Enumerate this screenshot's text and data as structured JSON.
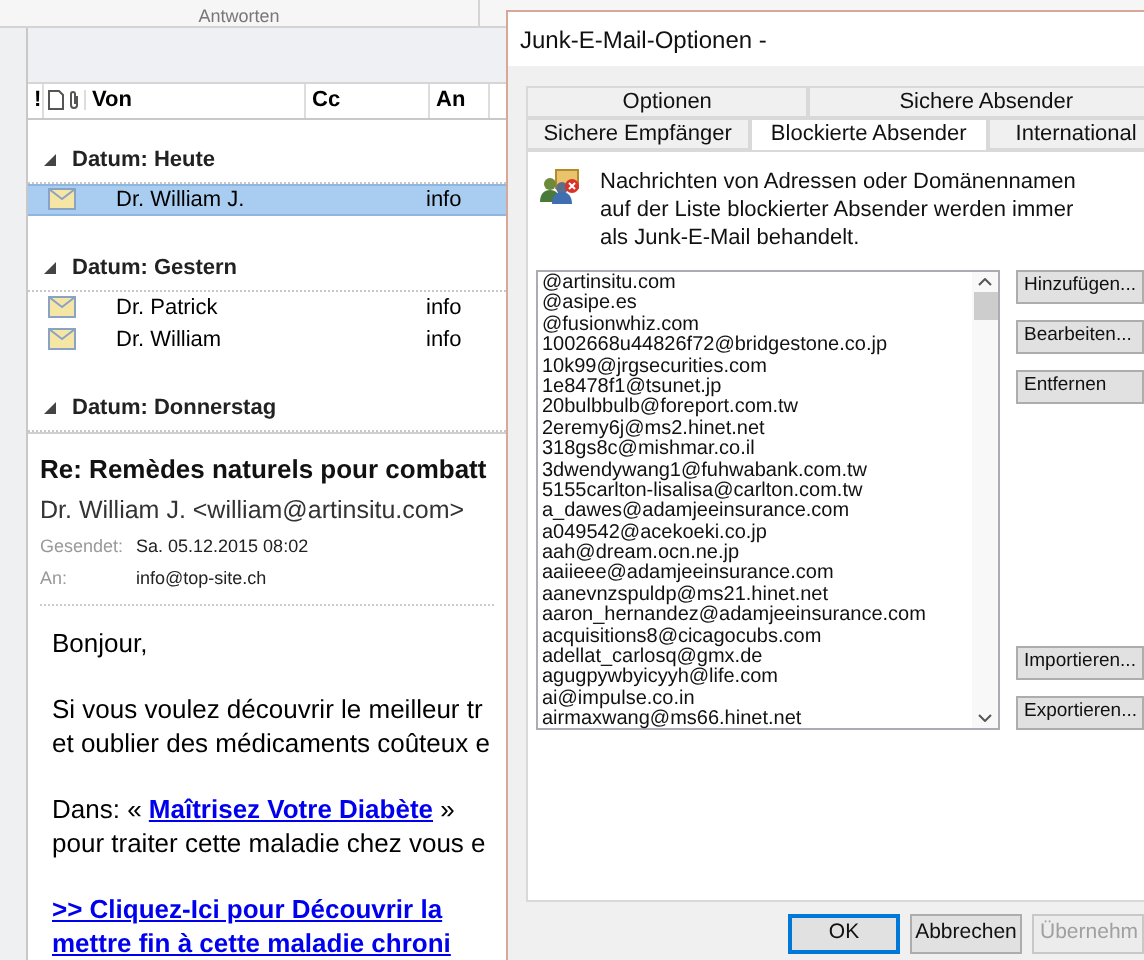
{
  "ribbon": {
    "groups": [
      "Antworten"
    ]
  },
  "mail_list": {
    "columns": [
      "!",
      "Von",
      "Cc",
      "An"
    ],
    "groups": [
      {
        "label": "Datum: Heute",
        "expanded": true,
        "rows": [
          {
            "from": "Dr. William J.",
            "to": "info",
            "selected": true
          }
        ]
      },
      {
        "label": "Datum: Gestern",
        "expanded": true,
        "rows": [
          {
            "from": "Dr. Patrick",
            "to": "info",
            "selected": false
          },
          {
            "from": "Dr. William",
            "to": "info",
            "selected": false
          }
        ]
      },
      {
        "label": "Datum: Donnerstag",
        "expanded": true
      }
    ]
  },
  "reading_pane": {
    "subject": "Re: Remèdes naturels pour combatt",
    "from": "Dr. William J. <william@artinsitu.com>",
    "sent_label": "Gesendet:",
    "sent": "Sa. 05.12.2015 08:02",
    "to_label": "An:",
    "to": "info@top-site.ch",
    "body": [
      {
        "kind": "text",
        "text": "Bonjour,"
      },
      {
        "kind": "text",
        "text": "Si vous voulez découvrir le meilleur tr\net oublier des médicaments coûteux e"
      },
      {
        "kind": "mixed",
        "before": "Dans: « ",
        "link": "Maîtrisez Votre Diabète",
        "after": " »",
        "next": "pour traiter cette maladie chez vous e"
      },
      {
        "kind": "link",
        "text": ">> Cliquez-Ici pour Découvrir la\nmettre fin à cette maladie chroni"
      }
    ]
  },
  "dialog": {
    "title": "Junk-E-Mail-Optionen -",
    "tabs": [
      [
        {
          "label": "Optionen",
          "selected": false
        },
        {
          "label": "Sichere Absender",
          "selected": false
        }
      ],
      [
        {
          "label": "Sichere Empfänger",
          "selected": false
        },
        {
          "label": "Blockierte Absender",
          "selected": true
        },
        {
          "label": "International",
          "selected": false
        }
      ]
    ],
    "description": "Nachrichten von Adressen oder Domänennamen auf der Liste blockierter Absender werden immer als Junk-E-Mail behandelt.",
    "blocked": [
      "@artinsitu.com",
      "@asipe.es",
      "@fusionwhiz.com",
      "1002668u44826f72@bridgestone.co.jp",
      "10k99@jrgsecurities.com",
      "1e8478f1@tsunet.jp",
      "20bulbbulb@foreport.com.tw",
      "2eremy6j@ms2.hinet.net",
      "318gs8c@mishmar.co.il",
      "3dwendywang1@fuhwabank.com.tw",
      "5155carlton-lisalisa@carlton.com.tw",
      "a_dawes@adamjeeinsurance.com",
      "a049542@acekoeki.co.jp",
      "aah@dream.ocn.ne.jp",
      "aaiieee@adamjeeinsurance.com",
      "aanevnzspuldp@ms21.hinet.net",
      "aaron_hernandez@adamjeeinsurance.com",
      "acquisitions8@cicagocubs.com",
      "adellat_carlosq@gmx.de",
      "agugpywbyicyyh@life.com",
      "ai@impulse.co.in",
      "airmaxwang@ms66.hinet.net"
    ],
    "side_buttons_top": [
      "Hinzufügen...",
      "Bearbeiten...",
      "Entfernen"
    ],
    "side_buttons_bottom": [
      "Importieren...",
      "Exportieren..."
    ],
    "footer_buttons": [
      {
        "label": "OK",
        "disabled": false,
        "default": true
      },
      {
        "label": "Abbrechen",
        "disabled": false,
        "default": false
      },
      {
        "label": "Übernehm",
        "disabled": true,
        "default": false
      }
    ]
  }
}
